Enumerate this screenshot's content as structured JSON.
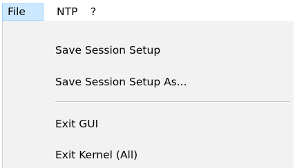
{
  "menubar": {
    "items": [
      {
        "label": "File"
      },
      {
        "label": "NTP"
      },
      {
        "label": "?"
      }
    ]
  },
  "file_menu": {
    "items": [
      {
        "label": "Save Session Setup"
      },
      {
        "label": "Save Session Setup As..."
      },
      {
        "label": "Exit GUI"
      },
      {
        "label": "Exit Kernel (All)"
      }
    ]
  },
  "colors": {
    "menubar_background": "#ffffff",
    "active_menu_highlight": "#cce8ff",
    "active_menu_border": "#99d1ff",
    "dropdown_background": "#f2f2f2",
    "text": "#000000"
  }
}
